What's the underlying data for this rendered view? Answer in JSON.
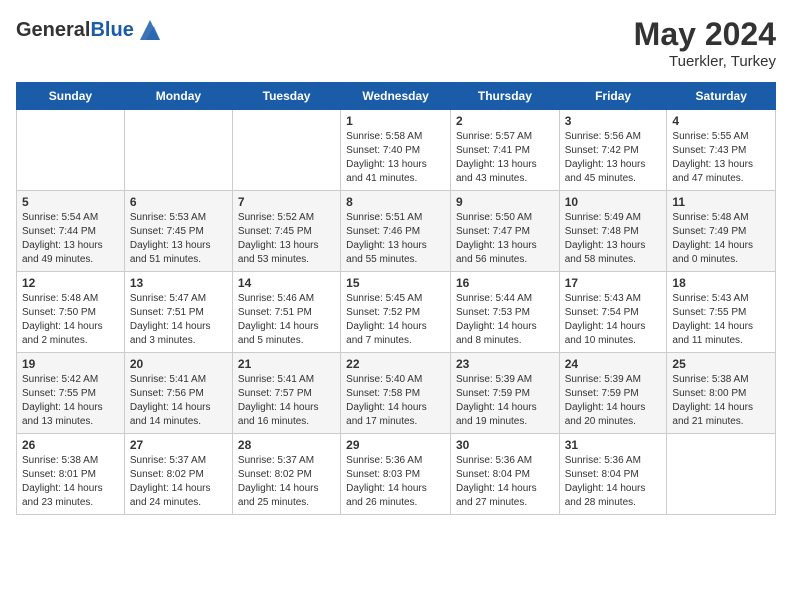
{
  "header": {
    "logo_general": "General",
    "logo_blue": "Blue",
    "month_year": "May 2024",
    "location": "Tuerkler, Turkey"
  },
  "days_of_week": [
    "Sunday",
    "Monday",
    "Tuesday",
    "Wednesday",
    "Thursday",
    "Friday",
    "Saturday"
  ],
  "weeks": [
    {
      "days": [
        {
          "num": "",
          "info": ""
        },
        {
          "num": "",
          "info": ""
        },
        {
          "num": "",
          "info": ""
        },
        {
          "num": "1",
          "info": "Sunrise: 5:58 AM\nSunset: 7:40 PM\nDaylight: 13 hours\nand 41 minutes."
        },
        {
          "num": "2",
          "info": "Sunrise: 5:57 AM\nSunset: 7:41 PM\nDaylight: 13 hours\nand 43 minutes."
        },
        {
          "num": "3",
          "info": "Sunrise: 5:56 AM\nSunset: 7:42 PM\nDaylight: 13 hours\nand 45 minutes."
        },
        {
          "num": "4",
          "info": "Sunrise: 5:55 AM\nSunset: 7:43 PM\nDaylight: 13 hours\nand 47 minutes."
        }
      ]
    },
    {
      "days": [
        {
          "num": "5",
          "info": "Sunrise: 5:54 AM\nSunset: 7:44 PM\nDaylight: 13 hours\nand 49 minutes."
        },
        {
          "num": "6",
          "info": "Sunrise: 5:53 AM\nSunset: 7:45 PM\nDaylight: 13 hours\nand 51 minutes."
        },
        {
          "num": "7",
          "info": "Sunrise: 5:52 AM\nSunset: 7:45 PM\nDaylight: 13 hours\nand 53 minutes."
        },
        {
          "num": "8",
          "info": "Sunrise: 5:51 AM\nSunset: 7:46 PM\nDaylight: 13 hours\nand 55 minutes."
        },
        {
          "num": "9",
          "info": "Sunrise: 5:50 AM\nSunset: 7:47 PM\nDaylight: 13 hours\nand 56 minutes."
        },
        {
          "num": "10",
          "info": "Sunrise: 5:49 AM\nSunset: 7:48 PM\nDaylight: 13 hours\nand 58 minutes."
        },
        {
          "num": "11",
          "info": "Sunrise: 5:48 AM\nSunset: 7:49 PM\nDaylight: 14 hours\nand 0 minutes."
        }
      ]
    },
    {
      "days": [
        {
          "num": "12",
          "info": "Sunrise: 5:48 AM\nSunset: 7:50 PM\nDaylight: 14 hours\nand 2 minutes."
        },
        {
          "num": "13",
          "info": "Sunrise: 5:47 AM\nSunset: 7:51 PM\nDaylight: 14 hours\nand 3 minutes."
        },
        {
          "num": "14",
          "info": "Sunrise: 5:46 AM\nSunset: 7:51 PM\nDaylight: 14 hours\nand 5 minutes."
        },
        {
          "num": "15",
          "info": "Sunrise: 5:45 AM\nSunset: 7:52 PM\nDaylight: 14 hours\nand 7 minutes."
        },
        {
          "num": "16",
          "info": "Sunrise: 5:44 AM\nSunset: 7:53 PM\nDaylight: 14 hours\nand 8 minutes."
        },
        {
          "num": "17",
          "info": "Sunrise: 5:43 AM\nSunset: 7:54 PM\nDaylight: 14 hours\nand 10 minutes."
        },
        {
          "num": "18",
          "info": "Sunrise: 5:43 AM\nSunset: 7:55 PM\nDaylight: 14 hours\nand 11 minutes."
        }
      ]
    },
    {
      "days": [
        {
          "num": "19",
          "info": "Sunrise: 5:42 AM\nSunset: 7:55 PM\nDaylight: 14 hours\nand 13 minutes."
        },
        {
          "num": "20",
          "info": "Sunrise: 5:41 AM\nSunset: 7:56 PM\nDaylight: 14 hours\nand 14 minutes."
        },
        {
          "num": "21",
          "info": "Sunrise: 5:41 AM\nSunset: 7:57 PM\nDaylight: 14 hours\nand 16 minutes."
        },
        {
          "num": "22",
          "info": "Sunrise: 5:40 AM\nSunset: 7:58 PM\nDaylight: 14 hours\nand 17 minutes."
        },
        {
          "num": "23",
          "info": "Sunrise: 5:39 AM\nSunset: 7:59 PM\nDaylight: 14 hours\nand 19 minutes."
        },
        {
          "num": "24",
          "info": "Sunrise: 5:39 AM\nSunset: 7:59 PM\nDaylight: 14 hours\nand 20 minutes."
        },
        {
          "num": "25",
          "info": "Sunrise: 5:38 AM\nSunset: 8:00 PM\nDaylight: 14 hours\nand 21 minutes."
        }
      ]
    },
    {
      "days": [
        {
          "num": "26",
          "info": "Sunrise: 5:38 AM\nSunset: 8:01 PM\nDaylight: 14 hours\nand 23 minutes."
        },
        {
          "num": "27",
          "info": "Sunrise: 5:37 AM\nSunset: 8:02 PM\nDaylight: 14 hours\nand 24 minutes."
        },
        {
          "num": "28",
          "info": "Sunrise: 5:37 AM\nSunset: 8:02 PM\nDaylight: 14 hours\nand 25 minutes."
        },
        {
          "num": "29",
          "info": "Sunrise: 5:36 AM\nSunset: 8:03 PM\nDaylight: 14 hours\nand 26 minutes."
        },
        {
          "num": "30",
          "info": "Sunrise: 5:36 AM\nSunset: 8:04 PM\nDaylight: 14 hours\nand 27 minutes."
        },
        {
          "num": "31",
          "info": "Sunrise: 5:36 AM\nSunset: 8:04 PM\nDaylight: 14 hours\nand 28 minutes."
        },
        {
          "num": "",
          "info": ""
        }
      ]
    }
  ]
}
